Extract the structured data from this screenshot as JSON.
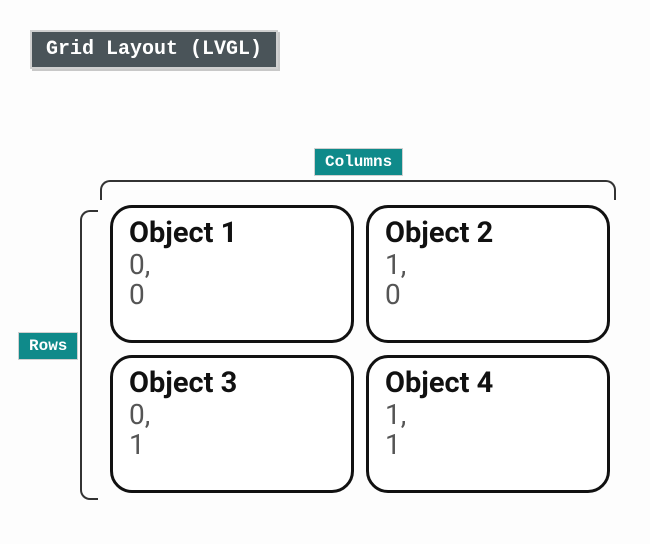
{
  "title": "Grid Layout (LVGL)",
  "labels": {
    "columns": "Columns",
    "rows": "Rows"
  },
  "cells": [
    {
      "title": "Object 1",
      "col": "0,",
      "row": "0"
    },
    {
      "title": "Object 2",
      "col": "1,",
      "row": "0"
    },
    {
      "title": "Object 3",
      "col": "0,",
      "row": "1"
    },
    {
      "title": "Object 4",
      "col": "1,",
      "row": "1"
    }
  ]
}
